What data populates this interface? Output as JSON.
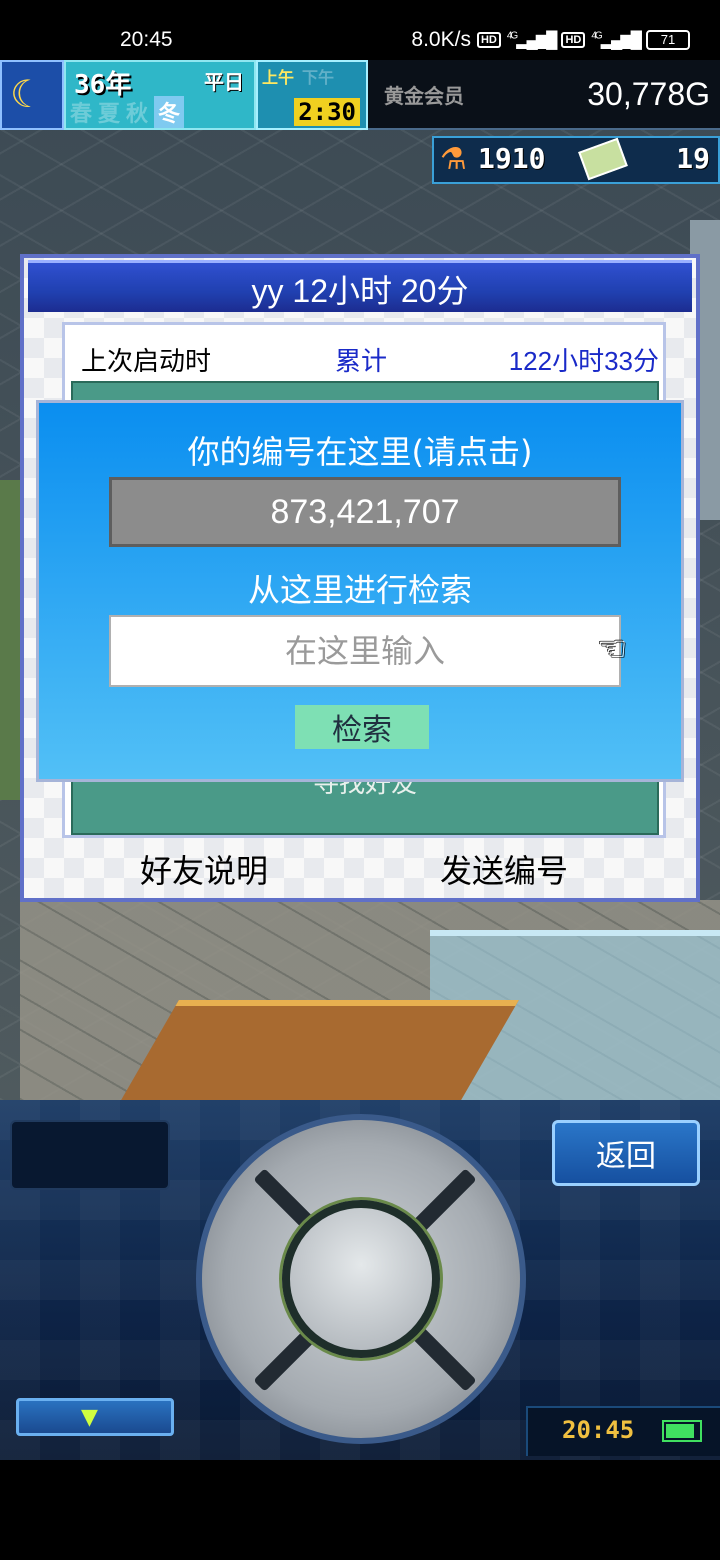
{
  "status_bar": {
    "time": "20:45",
    "net_speed": "8.0K/s",
    "net_type": "4G",
    "hd_label": "HD",
    "battery": "71"
  },
  "hud": {
    "year": "36",
    "year_unit": "年",
    "weekday": "平日",
    "seasons": [
      "春",
      "夏",
      "秋",
      "冬"
    ],
    "active_season": "冬",
    "am": "上午",
    "pm": "下午",
    "time": "2:30",
    "membership": "黄金会员",
    "gold": "30,778G",
    "research_points": "1910",
    "tickets": "19",
    "moon_icon": "moon-icon",
    "flask_icon": "flask-icon",
    "ticket_icon": "ticket-icon"
  },
  "friend_panel": {
    "title": "yy  12小时 20分",
    "last_start_label": "上次启动时",
    "total_label": "累计",
    "total_value": "122小时33分",
    "find_friend_label": "寻找好友",
    "friend_help_button": "好友说明",
    "send_id_button": "发送编号"
  },
  "search_dialog": {
    "id_label": "你的编号在这里(请点击)",
    "player_id": "873,421,707",
    "search_label": "从这里进行检索",
    "search_placeholder": "在这里输入",
    "search_button": "检索"
  },
  "controller": {
    "back_button": "返回",
    "clock": "20:45"
  }
}
